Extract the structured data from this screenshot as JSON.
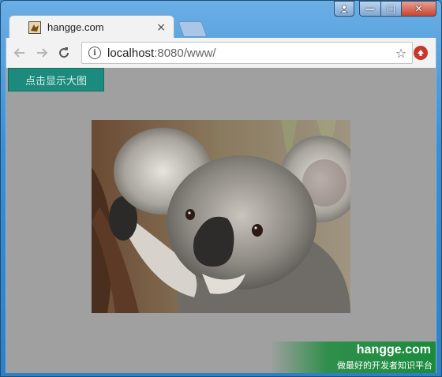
{
  "browser": {
    "tab": {
      "title": "hangge.com",
      "close_glyph": "×",
      "favicon": "hangge-favicon"
    },
    "address_bar": {
      "host": "localhost",
      "path": ":8080/www/",
      "info_glyph": "i",
      "star_glyph": "☆"
    },
    "controls": {
      "back": "arrow-left-icon",
      "forward": "arrow-right-icon",
      "reload": "reload-icon"
    },
    "window_buttons": {
      "min": "—",
      "max": "□",
      "close": "✕"
    }
  },
  "page": {
    "show_button_label": "点击显示大图",
    "image": {
      "subject": "koala-photo"
    },
    "watermark": {
      "title": "hangge.com",
      "subtitle": "做最好的开发者知识平台"
    }
  },
  "colors": {
    "page_background": "#a0a0a0",
    "button_background": "#1c8a7c",
    "watermark": "#1a8c3c",
    "extension": "#c8382a"
  }
}
